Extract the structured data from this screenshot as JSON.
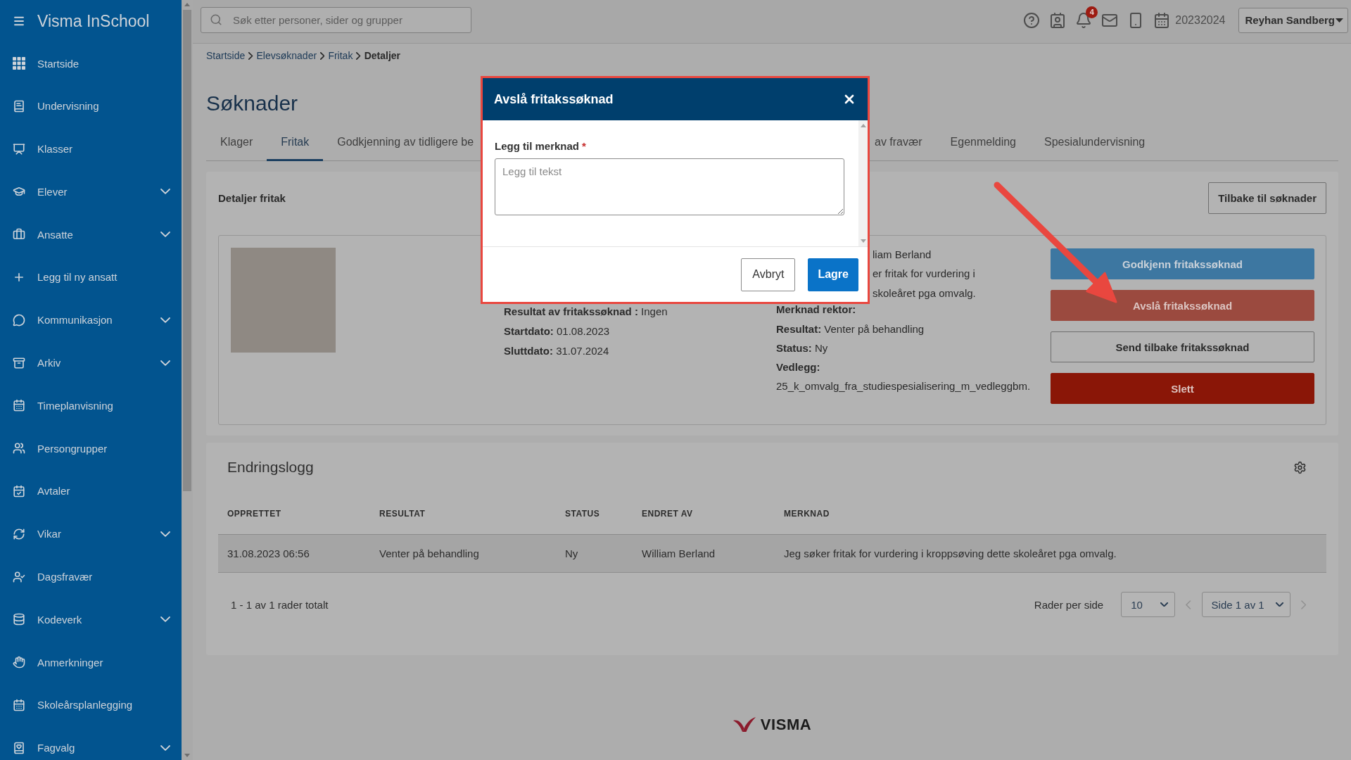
{
  "sidebar": {
    "title": "Visma InSchool",
    "items": [
      {
        "label": "Startside",
        "has_submenu": false
      },
      {
        "label": "Undervisning",
        "has_submenu": false
      },
      {
        "label": "Klasser",
        "has_submenu": false
      },
      {
        "label": "Elever",
        "has_submenu": true
      },
      {
        "label": "Ansatte",
        "has_submenu": true
      },
      {
        "label": "Legg til ny ansatt",
        "has_submenu": false
      },
      {
        "label": "Kommunikasjon",
        "has_submenu": true
      },
      {
        "label": "Arkiv",
        "has_submenu": true
      },
      {
        "label": "Timeplanvisning",
        "has_submenu": false
      },
      {
        "label": "Persongrupper",
        "has_submenu": false
      },
      {
        "label": "Avtaler",
        "has_submenu": false
      },
      {
        "label": "Vikar",
        "has_submenu": true
      },
      {
        "label": "Dagsfravær",
        "has_submenu": false
      },
      {
        "label": "Kodeverk",
        "has_submenu": true
      },
      {
        "label": "Anmerkninger",
        "has_submenu": false
      },
      {
        "label": "Skoleårsplanlegging",
        "has_submenu": false
      },
      {
        "label": "Fagvalg",
        "has_submenu": true
      }
    ]
  },
  "topbar": {
    "search": {
      "placeholder": "Søk etter personer, sider og grupper"
    },
    "notification_count": "4",
    "school_year": "20232024",
    "user_menu": "Reyhan Sandberg"
  },
  "breadcrumbs": [
    {
      "label": "Startside",
      "current": false
    },
    {
      "label": "Elevsøknader",
      "current": false
    },
    {
      "label": "Fritak",
      "current": false
    },
    {
      "label": "Detaljer",
      "current": true
    }
  ],
  "page_title": "Søknader",
  "tabs": [
    {
      "label": "Klager",
      "selected": false
    },
    {
      "label": "Fritak",
      "selected": true
    },
    {
      "label": "Godkjenning av tidligere be",
      "selected": false
    },
    {
      "label": "av fravær",
      "selected": false
    },
    {
      "label": "Egenmelding",
      "selected": false
    },
    {
      "label": "Spesialundervisning",
      "selected": false
    }
  ],
  "details": {
    "heading": "Detaljer fritak",
    "back_button": "Tilbake til søknader",
    "summary_fields": [
      {
        "label": "Resultat av fritakssøknad :",
        "value": "Ingen"
      },
      {
        "label": "Startdato:",
        "value": "01.08.2023"
      },
      {
        "label": "Sluttdato:",
        "value": "31.07.2024"
      }
    ],
    "partly_hidden_lines": [
      "liam Berland",
      "er fritak for vurdering i",
      "skoleåret pga omvalg."
    ],
    "fields": [
      {
        "label": "Merknad rektor:"
      },
      {
        "label": "Resultat:",
        "value": "Venter på behandling"
      },
      {
        "label": "Status:",
        "value": "Ny"
      },
      {
        "label": "Vedlegg:"
      }
    ],
    "attachment": "25_k_omvalg_fra_studiespesialisering_m_vedleggbm.",
    "actions": [
      {
        "label": "Godkjenn fritakssøknad",
        "kind": "approve"
      },
      {
        "label": "Avslå fritakssøknad",
        "kind": "reject"
      },
      {
        "label": "Send tilbake fritakssøknad",
        "kind": "return"
      },
      {
        "label": "Slett",
        "kind": "delete"
      }
    ]
  },
  "change_log": {
    "title": "Endringslogg",
    "columns": [
      "OPPRETTET",
      "RESULTAT",
      "STATUS",
      "ENDRET AV",
      "MERKNAD"
    ],
    "rows": [
      [
        "31.08.2023 06:56",
        "Venter på behandling",
        "Ny",
        "William Berland",
        "Jeg søker fritak for vurdering i kroppsøving dette skoleåret pga omvalg."
      ]
    ],
    "pagination": {
      "summary": "1 - 1 av 1 rader totalt",
      "rows_per_page_label": "Rader per side",
      "rows_per_page": "10",
      "page": "Side 1 av 1",
      "previous_disabled": true,
      "next_disabled": true
    }
  },
  "footer": {
    "logo_text": "VISMA"
  },
  "dialog": {
    "title": "Avslå fritakssøknad",
    "field": {
      "label": "Legg til merknad",
      "required_mark": "*",
      "placeholder": "Legg til tekst"
    },
    "buttons": [
      {
        "label": "Avbryt",
        "kind": "secondary"
      },
      {
        "label": "Lagre",
        "kind": "primary"
      }
    ]
  }
}
